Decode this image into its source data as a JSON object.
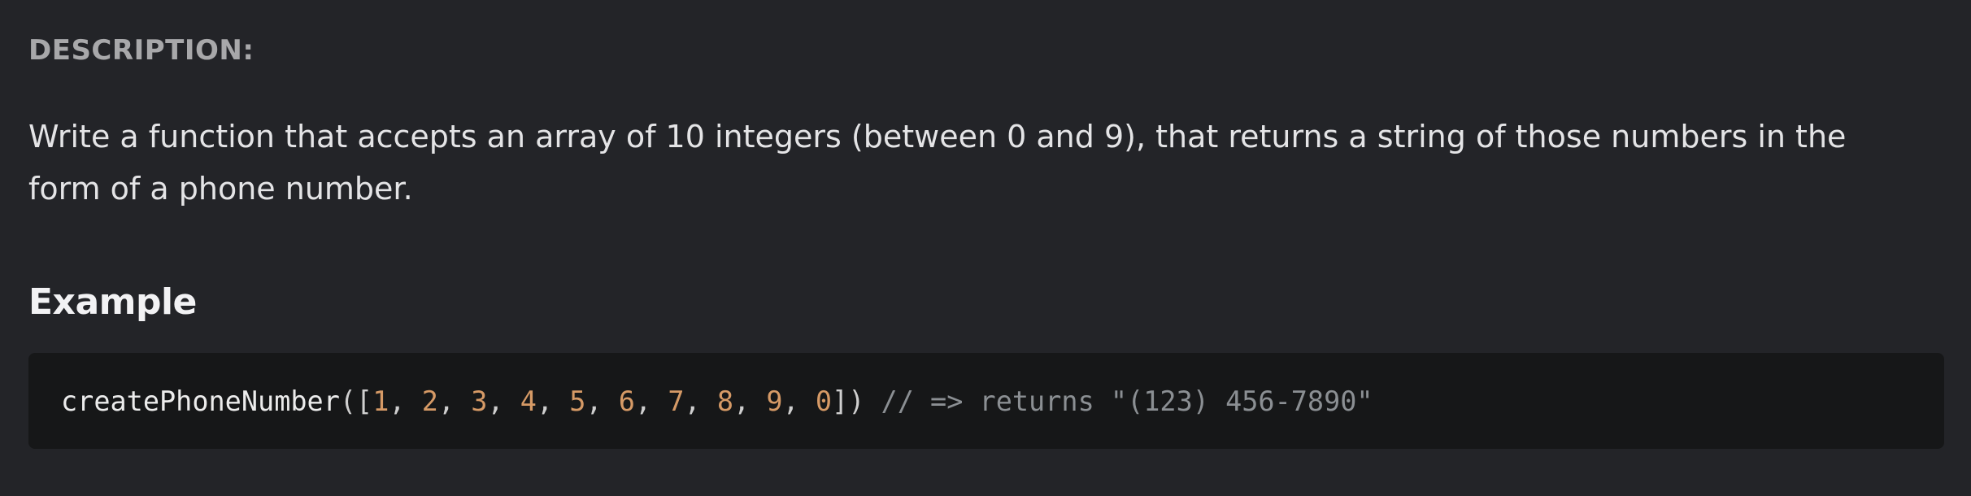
{
  "description": {
    "heading": "DESCRIPTION:",
    "text": "Write a function that accepts an array of 10 integers (between 0 and 9), that returns a string of those numbers in the form of a phone number."
  },
  "example": {
    "heading": "Example",
    "code": {
      "function_name": "createPhoneNumber",
      "open": "([",
      "numbers": [
        "1",
        "2",
        "3",
        "4",
        "5",
        "6",
        "7",
        "8",
        "9",
        "0"
      ],
      "separator": ", ",
      "close": "])",
      "comment": " // => returns \"(123) 456-7890\""
    }
  },
  "colors": {
    "background": "#232428",
    "code_background": "#161718",
    "number_token": "#d69a66",
    "comment_token": "#8b8f93",
    "text": "#e4e4e6",
    "muted_heading": "#a8a8aa"
  }
}
